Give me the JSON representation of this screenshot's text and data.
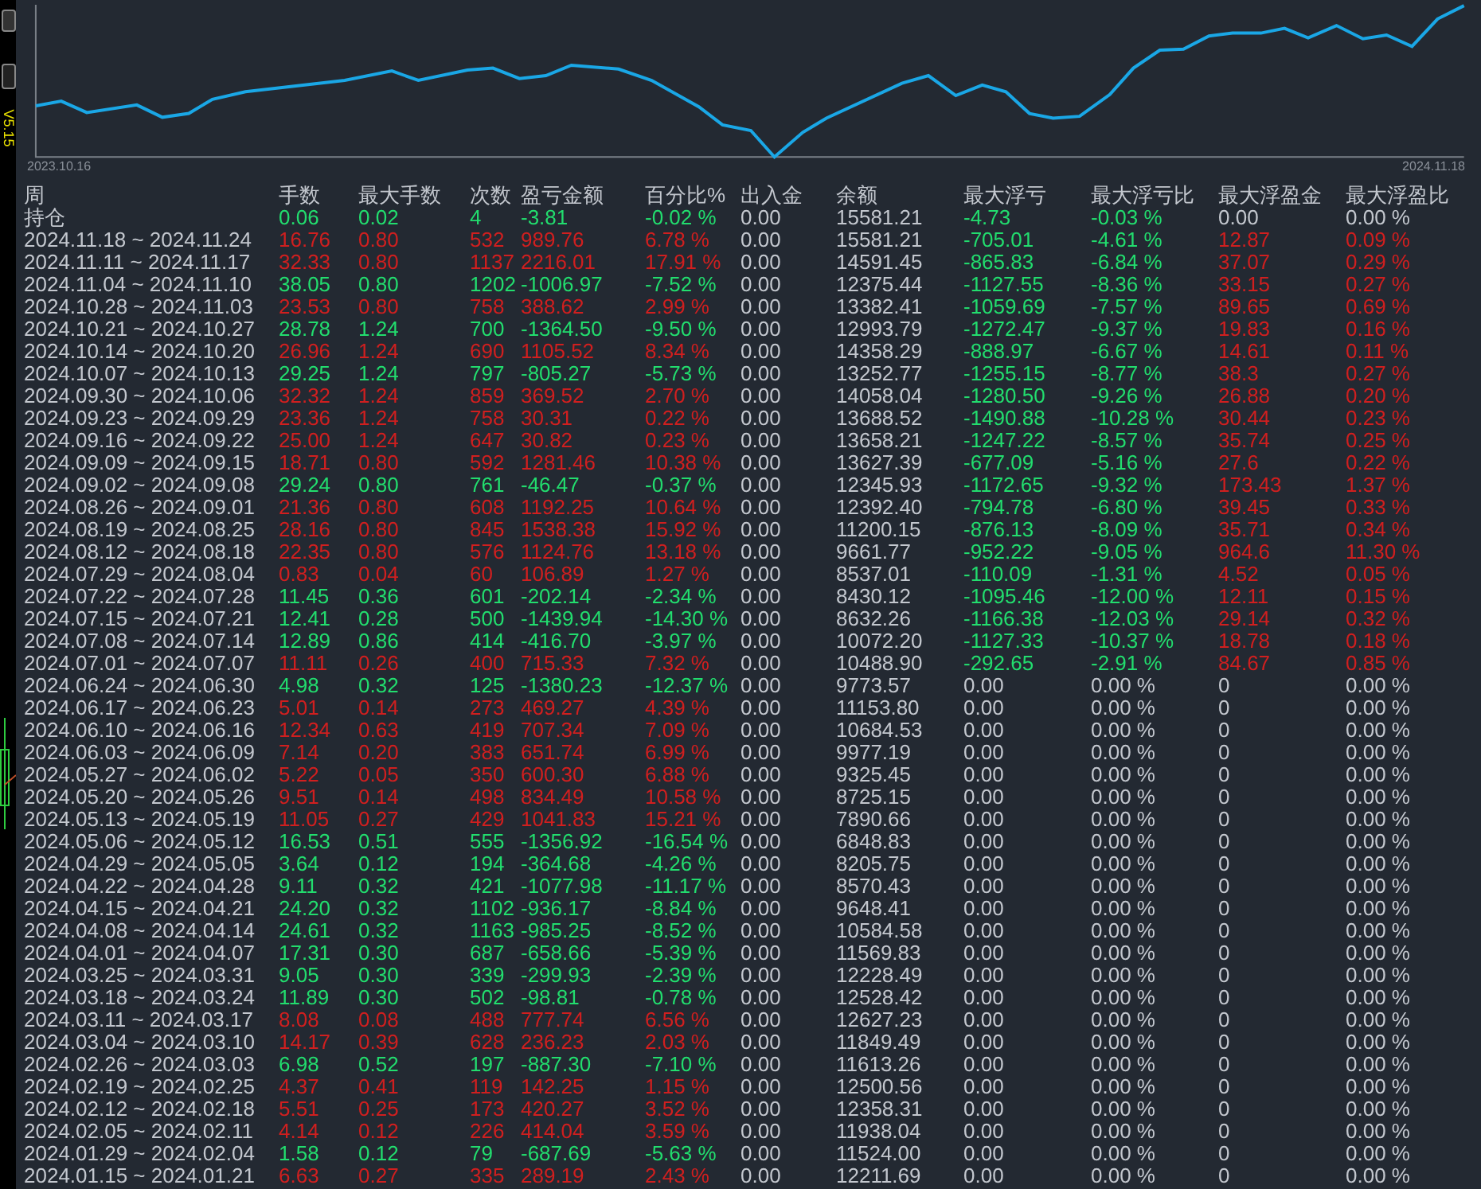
{
  "side_label": "V5.15",
  "chart": {
    "start_label": "2023.10.16",
    "end_label": "2024.11.18"
  },
  "table": {
    "columns": [
      "周",
      "手数",
      "最大手数",
      "次数",
      "盈亏金额",
      "百分比%",
      "出入金",
      "余额",
      "最大浮亏",
      "最大浮亏比",
      "最大浮盈金",
      "最大浮盈比"
    ],
    "rows": [
      {
        "cells": [
          "持仓",
          "0.06",
          "0.02",
          "4",
          "-3.81",
          "-0.02 %",
          "0.00",
          "15581.21",
          "-4.73",
          "-0.03 %",
          "0.00",
          "0.00 %"
        ],
        "kind": "down",
        "float_loss_active": true,
        "float_profit_active": false
      },
      {
        "cells": [
          "2024.11.18 ~ 2024.11.24",
          "16.76",
          "0.80",
          "532",
          "989.76",
          "6.78 %",
          "0.00",
          "15581.21",
          "-705.01",
          "-4.61 %",
          "12.87",
          "0.09 %"
        ],
        "kind": "up",
        "float_loss_active": true,
        "float_profit_active": true
      },
      {
        "cells": [
          "2024.11.11 ~ 2024.11.17",
          "32.33",
          "0.80",
          "1137",
          "2216.01",
          "17.91 %",
          "0.00",
          "14591.45",
          "-865.83",
          "-6.84 %",
          "37.07",
          "0.29 %"
        ],
        "kind": "up",
        "float_loss_active": true,
        "float_profit_active": true
      },
      {
        "cells": [
          "2024.11.04 ~ 2024.11.10",
          "38.05",
          "0.80",
          "1202",
          "-1006.97",
          "-7.52 %",
          "0.00",
          "12375.44",
          "-1127.55",
          "-8.36 %",
          "33.15",
          "0.27 %"
        ],
        "kind": "down",
        "float_loss_active": true,
        "float_profit_active": true
      },
      {
        "cells": [
          "2024.10.28 ~ 2024.11.03",
          "23.53",
          "0.80",
          "758",
          "388.62",
          "2.99 %",
          "0.00",
          "13382.41",
          "-1059.69",
          "-7.57 %",
          "89.65",
          "0.69 %"
        ],
        "kind": "up",
        "float_loss_active": true,
        "float_profit_active": true
      },
      {
        "cells": [
          "2024.10.21 ~ 2024.10.27",
          "28.78",
          "1.24",
          "700",
          "-1364.50",
          "-9.50 %",
          "0.00",
          "12993.79",
          "-1272.47",
          "-9.37 %",
          "19.83",
          "0.16 %"
        ],
        "kind": "down",
        "float_loss_active": true,
        "float_profit_active": true
      },
      {
        "cells": [
          "2024.10.14 ~ 2024.10.20",
          "26.96",
          "1.24",
          "690",
          "1105.52",
          "8.34 %",
          "0.00",
          "14358.29",
          "-888.97",
          "-6.67 %",
          "14.61",
          "0.11 %"
        ],
        "kind": "up",
        "float_loss_active": true,
        "float_profit_active": true
      },
      {
        "cells": [
          "2024.10.07 ~ 2024.10.13",
          "29.25",
          "1.24",
          "797",
          "-805.27",
          "-5.73 %",
          "0.00",
          "13252.77",
          "-1255.15",
          "-8.77 %",
          "38.3",
          "0.27 %"
        ],
        "kind": "down",
        "float_loss_active": true,
        "float_profit_active": true
      },
      {
        "cells": [
          "2024.09.30 ~ 2024.10.06",
          "32.32",
          "1.24",
          "859",
          "369.52",
          "2.70 %",
          "0.00",
          "14058.04",
          "-1280.50",
          "-9.26 %",
          "26.88",
          "0.20 %"
        ],
        "kind": "up",
        "float_loss_active": true,
        "float_profit_active": true
      },
      {
        "cells": [
          "2024.09.23 ~ 2024.09.29",
          "23.36",
          "1.24",
          "758",
          "30.31",
          "0.22 %",
          "0.00",
          "13688.52",
          "-1490.88",
          "-10.28 %",
          "30.44",
          "0.23 %"
        ],
        "kind": "up",
        "float_loss_active": true,
        "float_profit_active": true
      },
      {
        "cells": [
          "2024.09.16 ~ 2024.09.22",
          "25.00",
          "1.24",
          "647",
          "30.82",
          "0.23 %",
          "0.00",
          "13658.21",
          "-1247.22",
          "-8.57 %",
          "35.74",
          "0.25 %"
        ],
        "kind": "up",
        "float_loss_active": true,
        "float_profit_active": true
      },
      {
        "cells": [
          "2024.09.09 ~ 2024.09.15",
          "18.71",
          "0.80",
          "592",
          "1281.46",
          "10.38 %",
          "0.00",
          "13627.39",
          "-677.09",
          "-5.16 %",
          "27.6",
          "0.22 %"
        ],
        "kind": "up",
        "float_loss_active": true,
        "float_profit_active": true
      },
      {
        "cells": [
          "2024.09.02 ~ 2024.09.08",
          "29.24",
          "0.80",
          "761",
          "-46.47",
          "-0.37 %",
          "0.00",
          "12345.93",
          "-1172.65",
          "-9.32 %",
          "173.43",
          "1.37 %"
        ],
        "kind": "down",
        "float_loss_active": true,
        "float_profit_active": true
      },
      {
        "cells": [
          "2024.08.26 ~ 2024.09.01",
          "21.36",
          "0.80",
          "608",
          "1192.25",
          "10.64 %",
          "0.00",
          "12392.40",
          "-794.78",
          "-6.80 %",
          "39.45",
          "0.33 %"
        ],
        "kind": "up",
        "float_loss_active": true,
        "float_profit_active": true
      },
      {
        "cells": [
          "2024.08.19 ~ 2024.08.25",
          "28.16",
          "0.80",
          "845",
          "1538.38",
          "15.92 %",
          "0.00",
          "11200.15",
          "-876.13",
          "-8.09 %",
          "35.71",
          "0.34 %"
        ],
        "kind": "up",
        "float_loss_active": true,
        "float_profit_active": true
      },
      {
        "cells": [
          "2024.08.12 ~ 2024.08.18",
          "22.35",
          "0.80",
          "576",
          "1124.76",
          "13.18 %",
          "0.00",
          "9661.77",
          "-952.22",
          "-9.05 %",
          "964.6",
          "11.30 %"
        ],
        "kind": "up",
        "float_loss_active": true,
        "float_profit_active": true
      },
      {
        "cells": [
          "2024.07.29 ~ 2024.08.04",
          "0.83",
          "0.04",
          "60",
          "106.89",
          "1.27 %",
          "0.00",
          "8537.01",
          "-110.09",
          "-1.31 %",
          "4.52",
          "0.05 %"
        ],
        "kind": "up",
        "float_loss_active": true,
        "float_profit_active": true
      },
      {
        "cells": [
          "2024.07.22 ~ 2024.07.28",
          "11.45",
          "0.36",
          "601",
          "-202.14",
          "-2.34 %",
          "0.00",
          "8430.12",
          "-1095.46",
          "-12.00 %",
          "12.11",
          "0.15 %"
        ],
        "kind": "down",
        "float_loss_active": true,
        "float_profit_active": true
      },
      {
        "cells": [
          "2024.07.15 ~ 2024.07.21",
          "12.41",
          "0.28",
          "500",
          "-1439.94",
          "-14.30 %",
          "0.00",
          "8632.26",
          "-1166.38",
          "-12.03 %",
          "29.14",
          "0.32 %"
        ],
        "kind": "down",
        "float_loss_active": true,
        "float_profit_active": true
      },
      {
        "cells": [
          "2024.07.08 ~ 2024.07.14",
          "12.89",
          "0.86",
          "414",
          "-416.70",
          "-3.97 %",
          "0.00",
          "10072.20",
          "-1127.33",
          "-10.37 %",
          "18.78",
          "0.18 %"
        ],
        "kind": "down",
        "float_loss_active": true,
        "float_profit_active": true
      },
      {
        "cells": [
          "2024.07.01 ~ 2024.07.07",
          "11.11",
          "0.26",
          "400",
          "715.33",
          "7.32 %",
          "0.00",
          "10488.90",
          "-292.65",
          "-2.91 %",
          "84.67",
          "0.85 %"
        ],
        "kind": "up",
        "float_loss_active": true,
        "float_profit_active": true
      },
      {
        "cells": [
          "2024.06.24 ~ 2024.06.30",
          "4.98",
          "0.32",
          "125",
          "-1380.23",
          "-12.37 %",
          "0.00",
          "9773.57",
          "0.00",
          "0.00 %",
          "0",
          "0.00 %"
        ],
        "kind": "down",
        "float_loss_active": false,
        "float_profit_active": false
      },
      {
        "cells": [
          "2024.06.17 ~ 2024.06.23",
          "5.01",
          "0.14",
          "273",
          "469.27",
          "4.39 %",
          "0.00",
          "11153.80",
          "0.00",
          "0.00 %",
          "0",
          "0.00 %"
        ],
        "kind": "up",
        "float_loss_active": false,
        "float_profit_active": false
      },
      {
        "cells": [
          "2024.06.10 ~ 2024.06.16",
          "12.34",
          "0.63",
          "419",
          "707.34",
          "7.09 %",
          "0.00",
          "10684.53",
          "0.00",
          "0.00 %",
          "0",
          "0.00 %"
        ],
        "kind": "up",
        "float_loss_active": false,
        "float_profit_active": false
      },
      {
        "cells": [
          "2024.06.03 ~ 2024.06.09",
          "7.14",
          "0.20",
          "383",
          "651.74",
          "6.99 %",
          "0.00",
          "9977.19",
          "0.00",
          "0.00 %",
          "0",
          "0.00 %"
        ],
        "kind": "up",
        "float_loss_active": false,
        "float_profit_active": false
      },
      {
        "cells": [
          "2024.05.27 ~ 2024.06.02",
          "5.22",
          "0.05",
          "350",
          "600.30",
          "6.88 %",
          "0.00",
          "9325.45",
          "0.00",
          "0.00 %",
          "0",
          "0.00 %"
        ],
        "kind": "up",
        "float_loss_active": false,
        "float_profit_active": false
      },
      {
        "cells": [
          "2024.05.20 ~ 2024.05.26",
          "9.51",
          "0.14",
          "498",
          "834.49",
          "10.58 %",
          "0.00",
          "8725.15",
          "0.00",
          "0.00 %",
          "0",
          "0.00 %"
        ],
        "kind": "up",
        "float_loss_active": false,
        "float_profit_active": false
      },
      {
        "cells": [
          "2024.05.13 ~ 2024.05.19",
          "11.05",
          "0.27",
          "429",
          "1041.83",
          "15.21 %",
          "0.00",
          "7890.66",
          "0.00",
          "0.00 %",
          "0",
          "0.00 %"
        ],
        "kind": "up",
        "float_loss_active": false,
        "float_profit_active": false
      },
      {
        "cells": [
          "2024.05.06 ~ 2024.05.12",
          "16.53",
          "0.51",
          "555",
          "-1356.92",
          "-16.54 %",
          "0.00",
          "6848.83",
          "0.00",
          "0.00 %",
          "0",
          "0.00 %"
        ],
        "kind": "down",
        "float_loss_active": false,
        "float_profit_active": false
      },
      {
        "cells": [
          "2024.04.29 ~ 2024.05.05",
          "3.64",
          "0.12",
          "194",
          "-364.68",
          "-4.26 %",
          "0.00",
          "8205.75",
          "0.00",
          "0.00 %",
          "0",
          "0.00 %"
        ],
        "kind": "down",
        "float_loss_active": false,
        "float_profit_active": false
      },
      {
        "cells": [
          "2024.04.22 ~ 2024.04.28",
          "9.11",
          "0.32",
          "421",
          "-1077.98",
          "-11.17 %",
          "0.00",
          "8570.43",
          "0.00",
          "0.00 %",
          "0",
          "0.00 %"
        ],
        "kind": "down",
        "float_loss_active": false,
        "float_profit_active": false
      },
      {
        "cells": [
          "2024.04.15 ~ 2024.04.21",
          "24.20",
          "0.32",
          "1102",
          "-936.17",
          "-8.84 %",
          "0.00",
          "9648.41",
          "0.00",
          "0.00 %",
          "0",
          "0.00 %"
        ],
        "kind": "down",
        "float_loss_active": false,
        "float_profit_active": false
      },
      {
        "cells": [
          "2024.04.08 ~ 2024.04.14",
          "24.61",
          "0.32",
          "1163",
          "-985.25",
          "-8.52 %",
          "0.00",
          "10584.58",
          "0.00",
          "0.00 %",
          "0",
          "0.00 %"
        ],
        "kind": "down",
        "float_loss_active": false,
        "float_profit_active": false
      },
      {
        "cells": [
          "2024.04.01 ~ 2024.04.07",
          "17.31",
          "0.30",
          "687",
          "-658.66",
          "-5.39 %",
          "0.00",
          "11569.83",
          "0.00",
          "0.00 %",
          "0",
          "0.00 %"
        ],
        "kind": "down",
        "float_loss_active": false,
        "float_profit_active": false
      },
      {
        "cells": [
          "2024.03.25 ~ 2024.03.31",
          "9.05",
          "0.30",
          "339",
          "-299.93",
          "-2.39 %",
          "0.00",
          "12228.49",
          "0.00",
          "0.00 %",
          "0",
          "0.00 %"
        ],
        "kind": "down",
        "float_loss_active": false,
        "float_profit_active": false
      },
      {
        "cells": [
          "2024.03.18 ~ 2024.03.24",
          "11.89",
          "0.30",
          "502",
          "-98.81",
          "-0.78 %",
          "0.00",
          "12528.42",
          "0.00",
          "0.00 %",
          "0",
          "0.00 %"
        ],
        "kind": "down",
        "float_loss_active": false,
        "float_profit_active": false
      },
      {
        "cells": [
          "2024.03.11 ~ 2024.03.17",
          "8.08",
          "0.08",
          "488",
          "777.74",
          "6.56 %",
          "0.00",
          "12627.23",
          "0.00",
          "0.00 %",
          "0",
          "0.00 %"
        ],
        "kind": "up",
        "float_loss_active": false,
        "float_profit_active": false
      },
      {
        "cells": [
          "2024.03.04 ~ 2024.03.10",
          "14.17",
          "0.39",
          "628",
          "236.23",
          "2.03 %",
          "0.00",
          "11849.49",
          "0.00",
          "0.00 %",
          "0",
          "0.00 %"
        ],
        "kind": "up",
        "float_loss_active": false,
        "float_profit_active": false
      },
      {
        "cells": [
          "2024.02.26 ~ 2024.03.03",
          "6.98",
          "0.52",
          "197",
          "-887.30",
          "-7.10 %",
          "0.00",
          "11613.26",
          "0.00",
          "0.00 %",
          "0",
          "0.00 %"
        ],
        "kind": "down",
        "float_loss_active": false,
        "float_profit_active": false
      },
      {
        "cells": [
          "2024.02.19 ~ 2024.02.25",
          "4.37",
          "0.41",
          "119",
          "142.25",
          "1.15 %",
          "0.00",
          "12500.56",
          "0.00",
          "0.00 %",
          "0",
          "0.00 %"
        ],
        "kind": "up",
        "float_loss_active": false,
        "float_profit_active": false
      },
      {
        "cells": [
          "2024.02.12 ~ 2024.02.18",
          "5.51",
          "0.25",
          "173",
          "420.27",
          "3.52 %",
          "0.00",
          "12358.31",
          "0.00",
          "0.00 %",
          "0",
          "0.00 %"
        ],
        "kind": "up",
        "float_loss_active": false,
        "float_profit_active": false
      },
      {
        "cells": [
          "2024.02.05 ~ 2024.02.11",
          "4.14",
          "0.12",
          "226",
          "414.04",
          "3.59 %",
          "0.00",
          "11938.04",
          "0.00",
          "0.00 %",
          "0",
          "0.00 %"
        ],
        "kind": "up",
        "float_loss_active": false,
        "float_profit_active": false
      },
      {
        "cells": [
          "2024.01.29 ~ 2024.02.04",
          "1.58",
          "0.12",
          "79",
          "-687.69",
          "-5.63 %",
          "0.00",
          "11524.00",
          "0.00",
          "0.00 %",
          "0",
          "0.00 %"
        ],
        "kind": "down",
        "float_loss_active": false,
        "float_profit_active": false
      },
      {
        "cells": [
          "2024.01.15 ~ 2024.01.21",
          "6.63",
          "0.27",
          "335",
          "289.19",
          "2.43 %",
          "0.00",
          "12211.69",
          "0.00",
          "0.00 %",
          "0",
          "0.00 %"
        ],
        "kind": "up",
        "float_loss_active": false,
        "float_profit_active": false
      }
    ]
  }
}
